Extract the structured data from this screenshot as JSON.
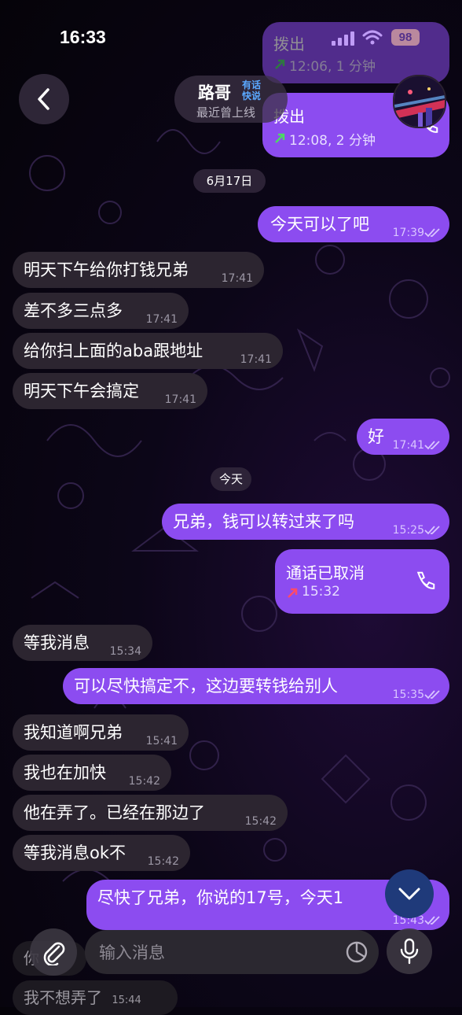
{
  "status": {
    "time": "16:33",
    "battery": "98"
  },
  "header": {
    "name": "路哥",
    "typing_line1": "有话",
    "typing_line2": "快说",
    "last_seen": "最近曾上线"
  },
  "call_top_1": {
    "title": "拨出",
    "detail": "12:06, 1 分钟"
  },
  "call_top_2": {
    "title": "拨出",
    "detail": "12:08, 2 分钟"
  },
  "date_1": "6月17日",
  "date_2": "今天",
  "messages": [
    {
      "text": "今天可以了吧",
      "time": "17:39"
    },
    {
      "text": "明天下午给你打钱兄弟",
      "time": "17:41"
    },
    {
      "text": "差不多三点多",
      "time": "17:41"
    },
    {
      "text": "给你扫上面的aba跟地址",
      "time": "17:41"
    },
    {
      "text": "明天下午会搞定",
      "time": "17:41"
    },
    {
      "text": "好",
      "time": "17:41"
    },
    {
      "text": "兄弟，钱可以转过来了吗",
      "time": "15:25"
    },
    {
      "text": "等我消息",
      "time": "15:34"
    },
    {
      "text": "可以尽快搞定不，这边要转钱给别人",
      "time": "15:35"
    },
    {
      "text": "我知道啊兄弟",
      "time": "15:41"
    },
    {
      "text": "我也在加快",
      "time": "15:42"
    },
    {
      "text": "他在弄了。已经在那边了",
      "time": "15:42"
    },
    {
      "text": "等我消息ok不",
      "time": "15:42"
    },
    {
      "text": "尽快了兄弟，你说的17号，今天1",
      "time": "15:43"
    }
  ],
  "call_cancelled": {
    "title": "通话已取消",
    "time": "15:32"
  },
  "below": {
    "partial_1": "你",
    "partial_2": "我不想弄了",
    "partial_time": "15:44"
  },
  "composer": {
    "placeholder": "输入消息"
  },
  "colors": {
    "outgoing": "#8c4cf0",
    "incoming": "#2c2530",
    "accent": "#5aa8ff"
  }
}
